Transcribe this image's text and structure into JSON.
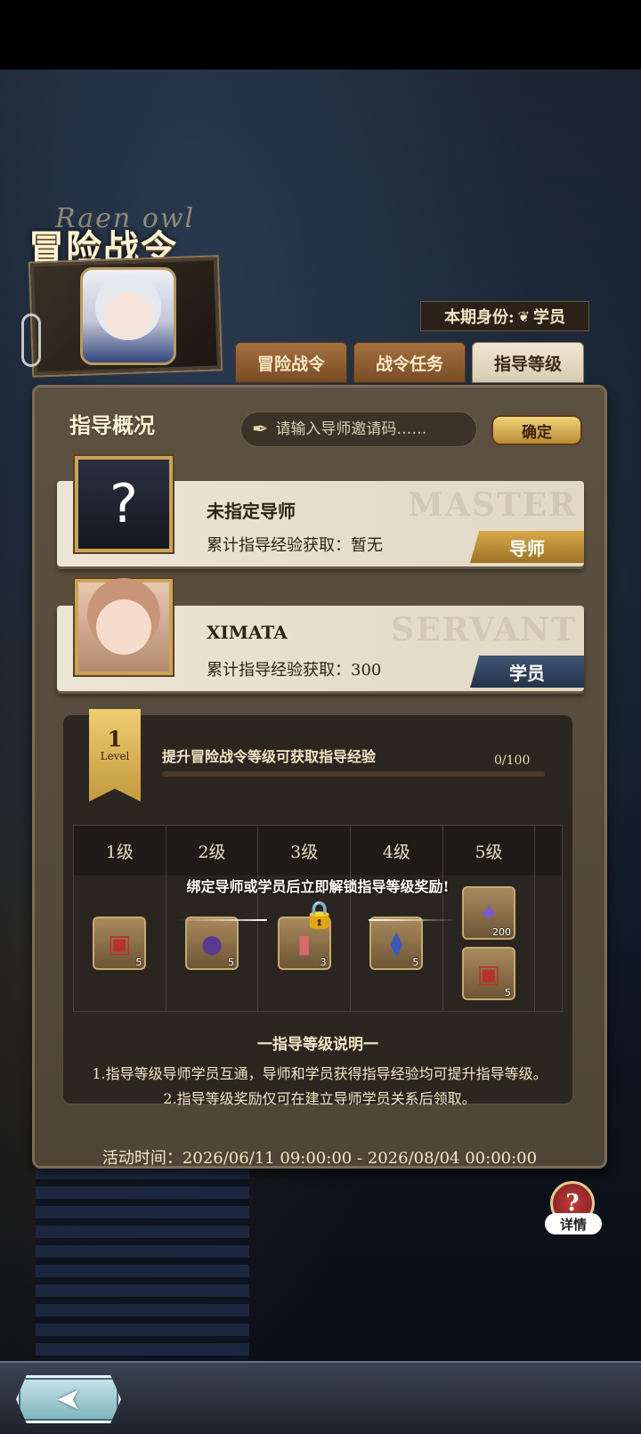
{
  "header": {
    "title_decoration": "Raen owl",
    "title": "冒险战令",
    "identity_label": "本期身份:",
    "identity_value": "学员",
    "identity_icon": "sprout-icon"
  },
  "tabs": [
    {
      "label": "冒险战令",
      "active": false
    },
    {
      "label": "战令任务",
      "active": false
    },
    {
      "label": "指导等级",
      "active": true
    }
  ],
  "overview": {
    "title": "指导概况",
    "invite_placeholder": "请输入导师邀请码……",
    "confirm_label": "确定"
  },
  "mentor_card": {
    "name": "未指定导师",
    "exp": "累计指导经验获取：暂无",
    "role": "导师",
    "watermark": "MASTER"
  },
  "student_card": {
    "name": "XIMATA",
    "exp": "累计指导经验获取：300",
    "role": "学员",
    "watermark": "SERVANT"
  },
  "level": {
    "number": "1",
    "label": "Level",
    "tip": "提升冒险战令等级可获取指导经验",
    "progress_text": "0/100",
    "progress_fraction": 0
  },
  "rewards": {
    "lock_message": "绑定导师或学员后立即解锁指导等级奖励!",
    "levels": [
      {
        "label": "1级",
        "items": [
          {
            "icon": "chest-icon",
            "qty": "5"
          }
        ]
      },
      {
        "label": "2级",
        "items": [
          {
            "icon": "orb-icon",
            "qty": "5"
          }
        ]
      },
      {
        "label": "3级",
        "items": [
          {
            "icon": "scroll-icon",
            "qty": "3"
          }
        ]
      },
      {
        "label": "4级",
        "items": [
          {
            "icon": "vial-icon",
            "qty": "5"
          }
        ]
      },
      {
        "label": "5级",
        "items": [
          {
            "icon": "star-icon",
            "qty": "200"
          },
          {
            "icon": "chest-icon",
            "qty": "5"
          }
        ]
      }
    ]
  },
  "rules": {
    "title": "一指导等级说明一",
    "line1": "1.指导等级导师学员互通，导师和学员获得指导经验均可提升指导等级。",
    "line2": "2.指导等级奖励仅可在建立导师学员关系后领取。"
  },
  "event_time": "活动时间：2026/06/11 09:00:00 - 2026/08/04 00:00:00",
  "help": {
    "symbol": "?",
    "label": "详情"
  },
  "back_icon": "back-arrow-icon"
}
